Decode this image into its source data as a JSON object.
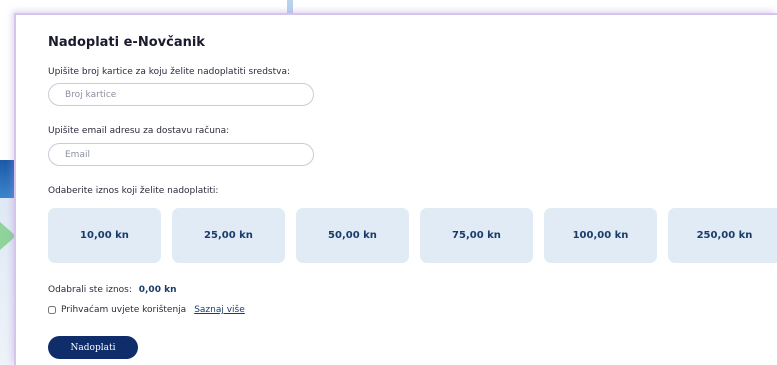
{
  "form": {
    "title": "Nadoplati e-Novčanik",
    "card_label": "Upišite broj kartice za koju želite nadoplatiti sredstva:",
    "card_placeholder": "Broj kartice",
    "email_label": "Upišite email adresu za dostavu računa:",
    "email_placeholder": "Email",
    "amount_label": "Odaberite iznos koji želite nadoplatiti:",
    "amounts": [
      "10,00 kn",
      "25,00 kn",
      "50,00 kn",
      "75,00 kn",
      "100,00 kn",
      "250,00 kn"
    ],
    "selected_label": "Odabrali ste iznos:",
    "selected_value": "0,00 kn",
    "terms_label": "Prihvaćam uvjete korištenja",
    "terms_link": "Saznaj više",
    "submit_label": "Nadoplati"
  },
  "colors": {
    "primary": "#0f2c6b",
    "amount_bg": "#e1ebf5",
    "accent_text": "#1b3b6b"
  }
}
